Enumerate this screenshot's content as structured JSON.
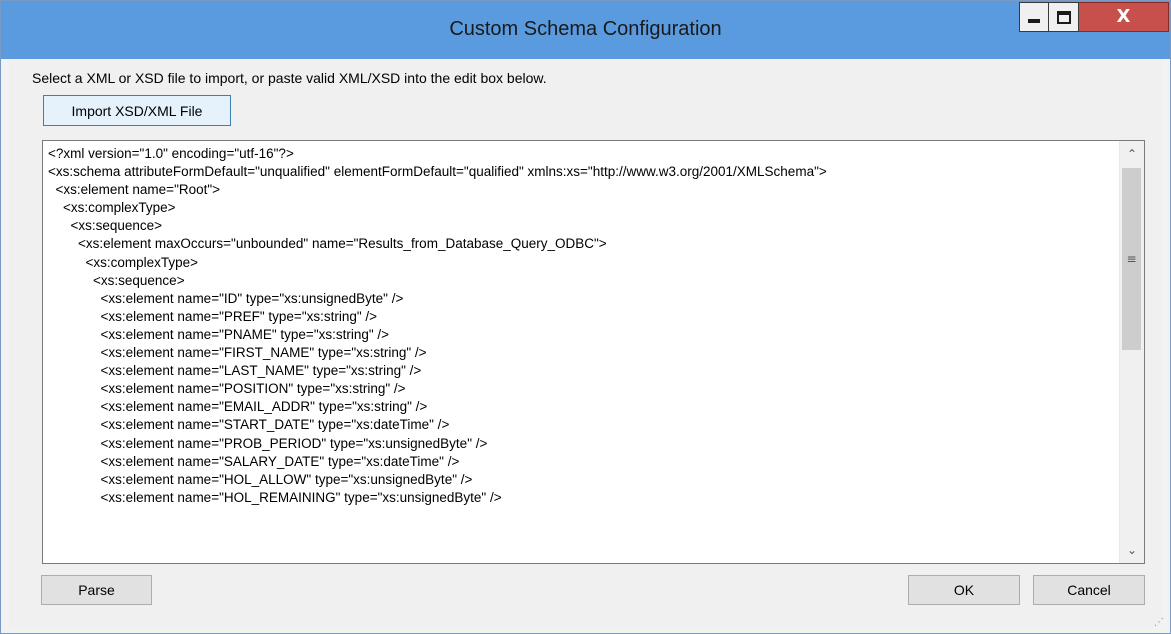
{
  "window": {
    "title": "Custom Schema Configuration",
    "minimize_glyph": "",
    "maximize_glyph": "",
    "close_glyph": "X"
  },
  "instruction": "Select a XML or XSD file to import, or paste valid XML/XSD into the edit box below.",
  "buttons": {
    "import_label": "Import XSD/XML File",
    "parse_label": "Parse",
    "ok_label": "OK",
    "cancel_label": "Cancel"
  },
  "editor": {
    "lines": [
      "<?xml version=\"1.0\" encoding=\"utf-16\"?>",
      "<xs:schema attributeFormDefault=\"unqualified\" elementFormDefault=\"qualified\" xmlns:xs=\"http://www.w3.org/2001/XMLSchema\">",
      "  <xs:element name=\"Root\">",
      "    <xs:complexType>",
      "      <xs:sequence>",
      "        <xs:element maxOccurs=\"unbounded\" name=\"Results_from_Database_Query_ODBC\">",
      "          <xs:complexType>",
      "            <xs:sequence>",
      "              <xs:element name=\"ID\" type=\"xs:unsignedByte\" />",
      "              <xs:element name=\"PREF\" type=\"xs:string\" />",
      "              <xs:element name=\"PNAME\" type=\"xs:string\" />",
      "              <xs:element name=\"FIRST_NAME\" type=\"xs:string\" />",
      "              <xs:element name=\"LAST_NAME\" type=\"xs:string\" />",
      "              <xs:element name=\"POSITION\" type=\"xs:string\" />",
      "              <xs:element name=\"EMAIL_ADDR\" type=\"xs:string\" />",
      "              <xs:element name=\"START_DATE\" type=\"xs:dateTime\" />",
      "              <xs:element name=\"PROB_PERIOD\" type=\"xs:unsignedByte\" />",
      "              <xs:element name=\"SALARY_DATE\" type=\"xs:dateTime\" />",
      "              <xs:element name=\"HOL_ALLOW\" type=\"xs:unsignedByte\" />",
      "              <xs:element name=\"HOL_REMAINING\" type=\"xs:unsignedByte\" />"
    ],
    "scroll_up_icon": "chevron-up-icon",
    "scroll_down_icon": "chevron-down-icon",
    "scroll_grip_icon": "grip-lines-icon"
  },
  "colors": {
    "titlebar": "#5a9be0",
    "close_button": "#c7504b"
  }
}
